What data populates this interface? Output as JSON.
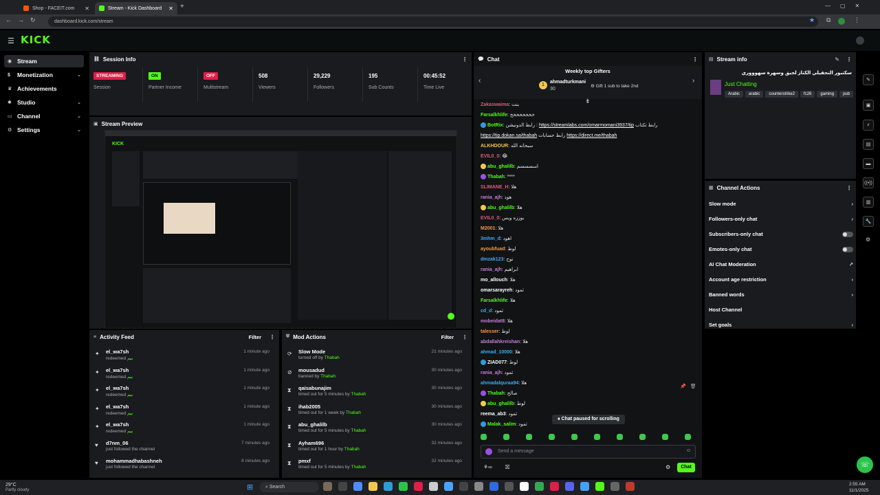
{
  "browser": {
    "tabs": [
      {
        "label": "Shop - FACEIT.com"
      },
      {
        "label": "Stream - Kick Dashboard"
      }
    ],
    "url": "dashboard.kick.com/stream"
  },
  "brand": {
    "logo": "KICK",
    "accent": "#53fc18"
  },
  "sidebar": {
    "items": [
      {
        "label": "Stream",
        "icon": "broadcast-icon"
      },
      {
        "label": "Monetization",
        "icon": "dollar-icon"
      },
      {
        "label": "Achievements",
        "icon": "trophy-icon"
      },
      {
        "label": "Studio",
        "icon": "gear-icon"
      },
      {
        "label": "Channel",
        "icon": "monitor-icon"
      },
      {
        "label": "Settings",
        "icon": "settings-icon"
      }
    ]
  },
  "session": {
    "title": "Session Info",
    "stats": [
      {
        "value": "STREAMING",
        "label": "Session",
        "badge": true,
        "color": "#e21d48"
      },
      {
        "value": "ON",
        "label": "Partner Income",
        "badge": true,
        "color": "#53fc18"
      },
      {
        "value": "OFF",
        "label": "Multistream",
        "badge": true,
        "color": "#e21d48"
      },
      {
        "value": "508",
        "label": "Viewers"
      },
      {
        "value": "29,229",
        "label": "Followers"
      },
      {
        "value": "195",
        "label": "Sub Counts"
      },
      {
        "value": "00:45:52",
        "label": "Time Live"
      }
    ]
  },
  "preview": {
    "title": "Stream Preview"
  },
  "activity": {
    "title": "Activity Feed",
    "filter": "Filter",
    "items": [
      {
        "user": "el_wa7sh",
        "action": "redeemed",
        "reward": "بيم",
        "time": "1 minute ago"
      },
      {
        "user": "el_wa7sh",
        "action": "redeemed",
        "reward": "بيم",
        "time": "1 minute ago"
      },
      {
        "user": "el_wa7sh",
        "action": "redeemed",
        "reward": "بيم",
        "time": "1 minute ago"
      },
      {
        "user": "el_wa7sh",
        "action": "redeemed",
        "reward": "بيم",
        "time": "1 minute ago"
      },
      {
        "user": "el_wa7sh",
        "action": "redeemed",
        "reward": "بيم",
        "time": "1 minute ago"
      },
      {
        "user": "d7nm_06",
        "action": "just followed the channel",
        "reward": "",
        "time": "7 minutes ago"
      },
      {
        "user": "mohammadhabashneh",
        "action": "just followed the channel",
        "reward": "",
        "time": "8 minutes ago"
      }
    ]
  },
  "mod": {
    "title": "Mod Actions",
    "filter": "Filter",
    "items": [
      {
        "user": "Slow Mode",
        "action": "turned off by",
        "by": "Thabah",
        "time": "21 minutes ago"
      },
      {
        "user": "mousadud",
        "action": "banned by",
        "by": "Thabah",
        "time": "30 minutes ago"
      },
      {
        "user": "qaisabunajim",
        "action": "timed out for 5 minutes by",
        "by": "Thabah",
        "time": "30 minutes ago"
      },
      {
        "user": "ihab2005",
        "action": "timed out for 1 week by",
        "by": "Thabah",
        "time": "30 minutes ago"
      },
      {
        "user": "abu_ghalilb",
        "action": "timed out for 5 minutes by",
        "by": "Thabah",
        "time": "30 minutes ago"
      },
      {
        "user": "Ayham696",
        "action": "timed out for 1 hour by",
        "by": "Thabah",
        "time": "32 minutes ago"
      },
      {
        "user": "pmxf",
        "action": "timed out for 5 minutes by",
        "by": "Thabah",
        "time": "32 minutes ago"
      }
    ]
  },
  "chat": {
    "title": "Chat",
    "gifters_title": "Weekly top Gifters",
    "top_gifter": "ahmadturkmani",
    "top_count": "30",
    "gift_hint": "Gift 1 sub to take 2nd",
    "paused": "Chat paused for scrolling",
    "placeholder": "Send a message",
    "send": "Chat",
    "messages": [
      {
        "user": "Zakaswaima",
        "color": "#e05a7a",
        "text": "بنت"
      },
      {
        "user": "Farsalkhlife",
        "color": "#53fc18",
        "text": "خخخخخخخخ"
      },
      {
        "user": "BotRix",
        "color": "#53fc18",
        "text": "رابط الدونيشن : ",
        "link": "https://streamlabs.com/omarmomani3937/tip",
        "text2": "رابط تكتاب"
      },
      {
        "user": "",
        "color": "#fff",
        "text": "",
        "link": "https://tip.dokan.sa/thabah",
        "text2": "رابط حسابات",
        "link2": "https://direct.me/thabah"
      },
      {
        "user": "ALKHDOUR",
        "color": "#f2c94c",
        "text": "سبحانه الله"
      },
      {
        "user": "EVIL0_0",
        "color": "#e05a7a",
        "text": "😂"
      },
      {
        "user": "abu_ghalilb",
        "color": "#53fc18",
        "text": "اسسسسم"
      },
      {
        "user": "Thabah",
        "color": "#53fc18",
        "text": "****"
      },
      {
        "user": "SLIMANE_H",
        "color": "#e05a7a",
        "text": "هلا"
      },
      {
        "user": "rania_ajh",
        "color": "#c77dd8",
        "text": "هود"
      },
      {
        "user": "abu_ghalilb",
        "color": "#53fc18",
        "text": "هلا"
      },
      {
        "user": "EVIL0_0",
        "color": "#e05a7a",
        "text": "بوززه ويس"
      },
      {
        "user": "M2001",
        "color": "#f2994a",
        "text": "هلا"
      },
      {
        "user": "3mhm_d",
        "color": "#3fa9f5",
        "text": "اهود"
      },
      {
        "user": "ayoubfuad",
        "color": "#f2994a",
        "text": "لوط"
      },
      {
        "user": "dmzak123",
        "color": "#3fa9f5",
        "text": "نوح"
      },
      {
        "user": "rania_ajh",
        "color": "#c77dd8",
        "text": "ابراهيم"
      },
      {
        "user": "mo_allouch",
        "color": "#fff",
        "text": "هلا"
      },
      {
        "user": "omarsarayreh",
        "color": "#fff",
        "text": "ثمود"
      },
      {
        "user": "Farsalkhlife",
        "color": "#53fc18",
        "text": "هلا"
      },
      {
        "user": "cd_d",
        "color": "#3fa9f5",
        "text": "ثمود"
      },
      {
        "user": "mobeidat8",
        "color": "#c77dd8",
        "text": "هلا"
      },
      {
        "user": "talesser",
        "color": "#f2994a",
        "text": "لوط"
      },
      {
        "user": "abdallahkreishan",
        "color": "#c77dd8",
        "text": "هلا"
      },
      {
        "user": "ahmad_10000",
        "color": "#3fa9f5",
        "text": "هلا"
      },
      {
        "user": "ZIAD077",
        "color": "#fff",
        "text": "لوط"
      },
      {
        "user": "rania_ajh",
        "color": "#c77dd8",
        "text": "ثمود"
      },
      {
        "user": "ahmadalquraa94",
        "color": "#3fa9f5",
        "text": "هلا"
      },
      {
        "user": "Thabah",
        "color": "#53fc18",
        "text": "صالح"
      },
      {
        "user": "abu_ghalilb",
        "color": "#53fc18",
        "text": "لوط"
      },
      {
        "user": "reema_ab3",
        "color": "#fff",
        "text": "ثمود"
      },
      {
        "user": "Malak_salim",
        "color": "#53fc18",
        "text": "ثمود"
      }
    ]
  },
  "streaminfo": {
    "title": "Stream info",
    "stream_title": "سكتبور التحقيلي الكتاز لجيق وسهرة سهوووري",
    "category": "Just Chatting",
    "tags": [
      "Arabic",
      "arabic",
      "counterstrike2",
      "fc26",
      "gaming",
      "pub"
    ]
  },
  "actions": {
    "title": "Channel Actions",
    "items": [
      {
        "label": "Slow mode",
        "kind": "arrow"
      },
      {
        "label": "Followers-only chat",
        "kind": "arrow"
      },
      {
        "label": "Subscribers-only chat",
        "kind": "toggle"
      },
      {
        "label": "Emotes-only chat",
        "kind": "toggle"
      },
      {
        "label": "AI Chat Moderation",
        "kind": "external"
      },
      {
        "label": "Account age restriction",
        "kind": "arrow"
      },
      {
        "label": "Banned words",
        "kind": "arrow"
      },
      {
        "label": "Host Channel",
        "kind": "none"
      },
      {
        "label": "Set goals",
        "kind": "arrow"
      }
    ]
  },
  "taskbar": {
    "weather_temp": "29°C",
    "weather_desc": "Partly cloudy",
    "search": "Search",
    "time": "2:55 AM",
    "date": "11/1/2025"
  }
}
